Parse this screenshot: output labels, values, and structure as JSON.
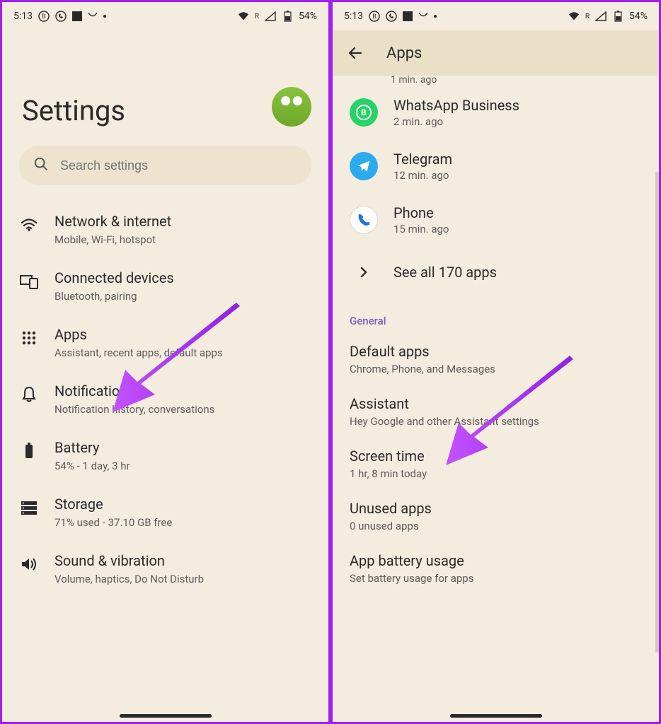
{
  "status": {
    "time": "5:13",
    "battery": "54%",
    "signal_label": "R"
  },
  "left": {
    "title": "Settings",
    "search_placeholder": "Search settings",
    "items": [
      {
        "title": "Network & internet",
        "sub": "Mobile, Wi-Fi, hotspot",
        "icon": "wifi"
      },
      {
        "title": "Connected devices",
        "sub": "Bluetooth, pairing",
        "icon": "devices"
      },
      {
        "title": "Apps",
        "sub": "Assistant, recent apps, default apps",
        "icon": "apps"
      },
      {
        "title": "Notifications",
        "sub": "Notification history, conversations",
        "icon": "bell"
      },
      {
        "title": "Battery",
        "sub": "54% - 1 day, 3 hr",
        "icon": "battery"
      },
      {
        "title": "Storage",
        "sub": "71% used - 37.10 GB free",
        "icon": "storage"
      },
      {
        "title": "Sound & vibration",
        "sub": "Volume, haptics, Do Not Disturb",
        "icon": "sound"
      }
    ]
  },
  "right": {
    "title": "Apps",
    "cutoff_time": "1 min. ago",
    "apps": [
      {
        "name": "WhatsApp Business",
        "time": "2 min. ago",
        "icon": "whatsapp",
        "color": "#25d366"
      },
      {
        "name": "Telegram",
        "time": "12 min. ago",
        "icon": "telegram",
        "color": "#2aabee"
      },
      {
        "name": "Phone",
        "time": "15 min. ago",
        "icon": "phone",
        "color": "#ffffff"
      }
    ],
    "see_all": "See all 170 apps",
    "section": "General",
    "items": [
      {
        "title": "Default apps",
        "sub": "Chrome, Phone, and Messages"
      },
      {
        "title": "Assistant",
        "sub": "Hey Google and other Assistant settings"
      },
      {
        "title": "Screen time",
        "sub": "1 hr, 8 min today"
      },
      {
        "title": "Unused apps",
        "sub": "0 unused apps"
      },
      {
        "title": "App battery usage",
        "sub": "Set battery usage for apps"
      }
    ]
  }
}
